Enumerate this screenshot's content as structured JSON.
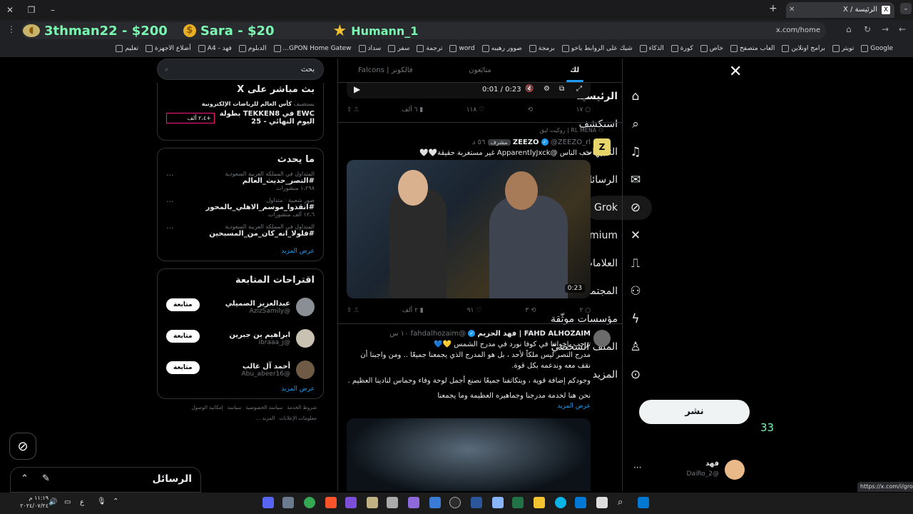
{
  "browser": {
    "tab_title": "الرئيسة / X",
    "url": "x.com/home",
    "status_url": "https://x.com/i/grok",
    "bookmarks": [
      "Google",
      "تويتر",
      "برامج اونلاين",
      "العاب متصفح",
      "خاص",
      "كورة",
      "الذكاء",
      "شيك على الروابط ياخو",
      "برمجة",
      "صوور رهيبه",
      "word",
      "ترجمة",
      "سفر",
      "سداد",
      "GPON Home Gatew...",
      "الدبلوم",
      "فهد - A4",
      "أضلاع الاجهزة",
      "تعليم"
    ]
  },
  "overlay": {
    "donor1": "3thman22 - $200",
    "donor2": "Sara - $20",
    "donor3": "Humann_1",
    "counter": "33"
  },
  "nav": {
    "items": [
      {
        "label": "الرئيسيّة",
        "icon": "home-icon",
        "glyph": "⌂"
      },
      {
        "label": "استكشف",
        "icon": "search-icon",
        "glyph": "⌕"
      },
      {
        "label": "التنبيهات",
        "icon": "bell-icon",
        "glyph": "♫"
      },
      {
        "label": "الرسائل",
        "icon": "envelope-icon",
        "glyph": "✉"
      },
      {
        "label": "Grok",
        "icon": "grok-icon",
        "glyph": "⊘"
      },
      {
        "label": "Premium",
        "icon": "x-icon",
        "glyph": "✕"
      },
      {
        "label": "العلامات المرجعية",
        "icon": "bookmark-icon",
        "glyph": "⎍"
      },
      {
        "label": "المجتمعات",
        "icon": "people-icon",
        "glyph": "⚇"
      },
      {
        "label": "مؤسسات موثّقة",
        "icon": "lightning-icon",
        "glyph": "ϟ"
      },
      {
        "label": "الملف الشخصيّ",
        "icon": "person-icon",
        "glyph": "♙"
      },
      {
        "label": "المزيد",
        "icon": "more-icon",
        "glyph": "⊙"
      }
    ],
    "post_label": "نشر",
    "user_name": "فهد",
    "user_handle": "@DaiRo_2"
  },
  "feed": {
    "tabs": [
      "لك",
      "متابَعون",
      "فالكونز | Falcons"
    ],
    "video1": {
      "time": "0:01 / 0:23",
      "replies": "١٧",
      "reposts": "",
      "likes": "١١٨",
      "views": "٦ ألف"
    },
    "tweet1": {
      "context": "RL MENA | روكيت ليق",
      "name": "ZEEZO",
      "handle": "@ZEEZO_rl",
      "badge": "مشرف",
      "time": "٥٦ د",
      "text": "حب الناس @ApparentlyJxck غير مستغربة حقيقة🤍🤍",
      "duration": "0:23",
      "replies": "٢",
      "reposts": "٣",
      "likes": "٩١",
      "views": "٢ ألف"
    },
    "tweet2": {
      "name": "FAHD ALHOZAIM | فهد الحزيم",
      "handle": "@fahdalhozaim",
      "time": "١٠ س",
      "lines": [
        "ترحب بإخواننا في كوفا نورد في مدرج الشمس 💛💙",
        "مدرج النصر ليس ملكاً لأحد ، بل هو المدرج الذي يجمعنا جميعًا .. ومن واجبنا أن نقف معه وندعمه بكل قوة.",
        "وجودكم إضافة قوية ، وبتكاتفنا جميعًا نصنع أجمل لوحة وفاء وحماس لنادينا العظيم .",
        "نحن هنا لخدمة مدرجنا وجماهيره العظيمة وما يجمعنا"
      ],
      "show_more": "عرض المزيد"
    }
  },
  "right": {
    "search_placeholder": "بحث",
    "live": {
      "title": "بث مباشر على X",
      "host": "يستضيف",
      "host_name": "كأس العالم للرياضات الإلكترونية",
      "event": "EWC في TEKKEN8 بطولة اليوم النهائي - 25",
      "listeners": "+٢،٤ ألف"
    },
    "trending": {
      "title": "ما يحدث",
      "items": [
        {
          "cat": "المتداول في المملكة العربية السعودية",
          "tag": "#النصر_حديث_العالم",
          "count": "١،٢٩٨ منشورات"
        },
        {
          "cat": "صور شعبية · متداول",
          "tag": "#انقذوا_موسم_الاهلي_بالمحور",
          "count": "١٢،٦ ألف منشورات"
        },
        {
          "cat": "المتداول في المملكة العربية السعودية",
          "tag": "#فلولا_انه_كان_من_المسبحين",
          "count": ""
        }
      ],
      "show_more": "عرض المزيد"
    },
    "who": {
      "title": "اقتراحات المتابعة",
      "items": [
        {
          "name": "عبدالعزيز الصميلي",
          "handle": "@AzizSamily",
          "btn": "متابعة"
        },
        {
          "name": "ابراهيم بن جبرين",
          "handle": "@ibraaa_j",
          "btn": "متابعة"
        },
        {
          "name": "أحمد آل غالب",
          "handle": "@Abu_abeer16",
          "btn": "متابعة"
        }
      ],
      "show_more": "عرض المزيد"
    },
    "footer": [
      "شروط الخدمة",
      "سياسة الخصوصية",
      "سياسة",
      "إمكانية الوصول",
      "معلومات الإعلانات",
      "المزيد ..."
    ]
  },
  "messages": {
    "title": "الرسائل"
  },
  "taskbar": {
    "time": "١١:١٩ م",
    "date": "٢٠٢٤/٠٧/٢٤",
    "lang": "ع"
  }
}
